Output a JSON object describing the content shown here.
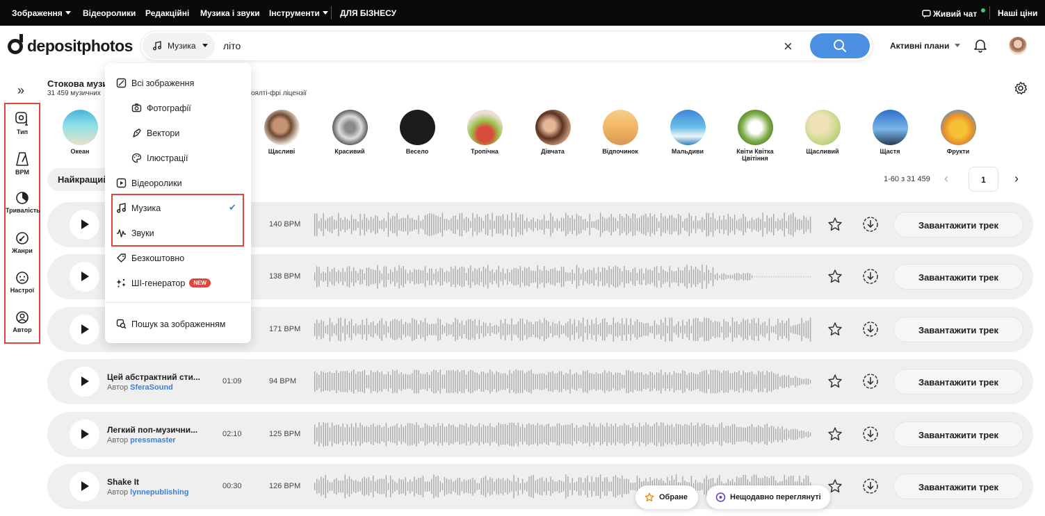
{
  "topnav": {
    "images": "Зображення",
    "videos": "Відеоролики",
    "editorial": "Редакційні",
    "music": "Музика і звуки",
    "tools": "Інструменти",
    "business": "ДЛЯ БІЗНЕСУ",
    "live_chat": "Живий чат",
    "prices": "Наші ціни"
  },
  "header": {
    "logo": "depositphotos",
    "search_type": "Музика",
    "search_query": "літо",
    "active_plans": "Активні плани"
  },
  "sidebar": {
    "filters": [
      "Тип",
      "BPM",
      "Тривалість",
      "Жанри",
      "Настрої",
      "Автор"
    ]
  },
  "page": {
    "title": "Стокова музи",
    "subtitle": "31 459 музичних",
    "subtitle_rest": "оялті-фрі ліцензії",
    "sort_label": "Найкращий"
  },
  "categories": [
    "Океан",
    "Щасливі",
    "Красивий",
    "Весело",
    "Тропічна",
    "Дівчата",
    "Відпочинок",
    "Мальдиви",
    "Квіти Квітка Цвітіння",
    "Щасливий",
    "Щастя",
    "Фрукти"
  ],
  "pager": {
    "count": "1-60 з 31 459",
    "page": "1"
  },
  "tracks": [
    {
      "title": "",
      "author_prefix": "",
      "author": "",
      "duration": "",
      "bpm": "140 BPM",
      "button": "Завантажити трек"
    },
    {
      "title": "",
      "author_prefix": "",
      "author": "",
      "duration": "",
      "bpm": "138 BPM",
      "button": "Завантажити трек"
    },
    {
      "title": "",
      "author_prefix": "",
      "author": "",
      "duration": "",
      "bpm": "171 BPM",
      "button": "Завантажити трек"
    },
    {
      "title": "Цей абстрактний сти...",
      "author_prefix": "Автор",
      "author": "SferaSound",
      "duration": "01:09",
      "bpm": "94 BPM",
      "button": "Завантажити трек"
    },
    {
      "title": "Легкий поп-музични...",
      "author_prefix": "Автор",
      "author": "pressmaster",
      "duration": "02:10",
      "bpm": "125 BPM",
      "button": "Завантажити трек"
    },
    {
      "title": "Shake It",
      "author_prefix": "Автор",
      "author": "lynnepublishing",
      "duration": "00:30",
      "bpm": "126 BPM",
      "button": "Завантажити трек"
    }
  ],
  "dropdown": {
    "all_images": "Всі зображення",
    "photos": "Фотографії",
    "vectors": "Вектори",
    "illustrations": "Ілюстрації",
    "videos": "Відеоролики",
    "music": "Музика",
    "sounds": "Звуки",
    "free": "Безкоштовно",
    "ai": "ШІ-генератор",
    "ai_badge": "NEW",
    "search_by_image": "Пошук за зображенням"
  },
  "floating": {
    "favorites": "Обране",
    "recent": "Нещодавно переглянуті"
  },
  "colors": {
    "accent": "#4b8fe2",
    "highlight": "#e0463a",
    "author_link": "#3c7fd6"
  }
}
